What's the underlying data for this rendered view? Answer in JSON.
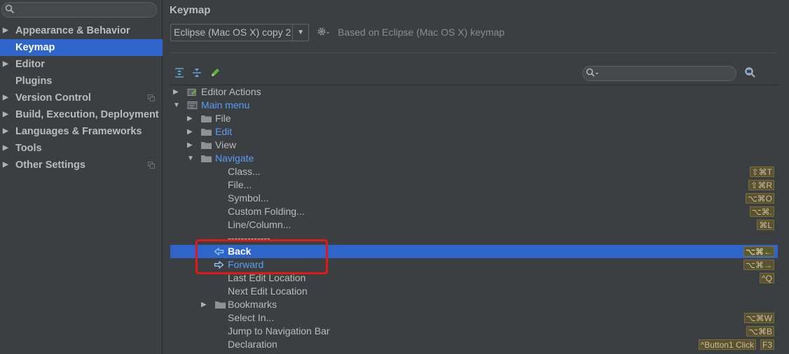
{
  "sidebar": {
    "search_placeholder": "",
    "items": [
      {
        "label": "Appearance & Behavior",
        "expandable": true
      },
      {
        "label": "Keymap",
        "expandable": false,
        "selected": true
      },
      {
        "label": "Editor",
        "expandable": true
      },
      {
        "label": "Plugins",
        "expandable": false
      },
      {
        "label": "Version Control",
        "expandable": true,
        "project_icon": true
      },
      {
        "label": "Build, Execution, Deployment",
        "expandable": true
      },
      {
        "label": "Languages & Frameworks",
        "expandable": true
      },
      {
        "label": "Tools",
        "expandable": true
      },
      {
        "label": "Other Settings",
        "expandable": true,
        "project_icon": true
      }
    ]
  },
  "main": {
    "title": "Keymap",
    "scheme_value": "Eclipse (Mac OS X) copy 2",
    "based_on": "Based on Eclipse (Mac OS X) keymap",
    "filter_placeholder": ""
  },
  "tree": {
    "rows": [
      {
        "text": "Editor Actions",
        "level": 0,
        "expander": "collapsed",
        "icon": "editor-actions-icon"
      },
      {
        "text": "Main menu",
        "level": 0,
        "expander": "expanded",
        "icon": "menu-icon",
        "modified": true
      },
      {
        "text": "File",
        "level": 1,
        "expander": "collapsed",
        "icon": "folder-icon"
      },
      {
        "text": "Edit",
        "level": 1,
        "expander": "collapsed",
        "icon": "folder-icon",
        "modified": true
      },
      {
        "text": "View",
        "level": 1,
        "expander": "collapsed",
        "icon": "folder-icon"
      },
      {
        "text": "Navigate",
        "level": 1,
        "expander": "expanded",
        "icon": "folder-icon",
        "modified": true
      },
      {
        "text": "Class...",
        "level": 2,
        "shortcuts": [
          "⇧⌘T"
        ]
      },
      {
        "text": "File...",
        "level": 2,
        "shortcuts": [
          "⇧⌘R"
        ]
      },
      {
        "text": "Symbol...",
        "level": 2,
        "shortcuts": [
          "⌥⌘O"
        ]
      },
      {
        "text": "Custom Folding...",
        "level": 2,
        "shortcuts": [
          "⌥⌘."
        ]
      },
      {
        "text": "Line/Column...",
        "level": 2,
        "shortcuts": [
          "⌘L"
        ]
      },
      {
        "text": "-------------",
        "level": 2
      },
      {
        "text": "Back",
        "level": 2,
        "icon": "back-arrow-icon",
        "selected": true,
        "shortcuts": [
          "⌥⌘←"
        ]
      },
      {
        "text": "Forward",
        "level": 2,
        "icon": "forward-arrow-icon",
        "modified": true,
        "shortcuts": [
          "⌥⌘→"
        ]
      },
      {
        "text": "Last Edit Location",
        "level": 2,
        "shortcuts": [
          "^Q"
        ]
      },
      {
        "text": "Next Edit Location",
        "level": 2
      },
      {
        "text": "Bookmarks",
        "level": 2,
        "expander": "collapsed",
        "icon": "folder-icon"
      },
      {
        "text": "Select In...",
        "level": 2,
        "shortcuts": [
          "⌥⌘W"
        ]
      },
      {
        "text": "Jump to Navigation Bar",
        "level": 2,
        "shortcuts": [
          "⌥⌘B"
        ]
      },
      {
        "text": "Declaration",
        "level": 2,
        "shortcuts": [
          "F3",
          "^Button1 Click"
        ]
      }
    ]
  },
  "colors": {
    "selection": "#2f65ca",
    "modified_text": "#589df6",
    "annotation_box": "#e0191b"
  }
}
